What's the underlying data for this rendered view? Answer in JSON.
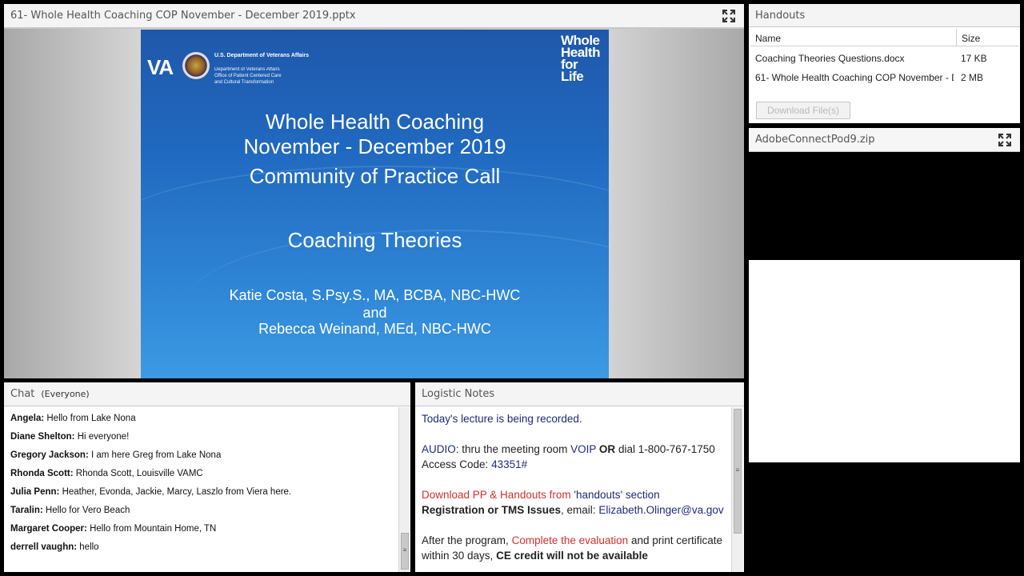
{
  "share_pod": {
    "title": "61- Whole Health Coaching COP November - December  2019.pptx",
    "slide": {
      "va_mark": "VA",
      "department": "U.S. Department of Veterans Affairs",
      "office": "Department of Veterans Affairs Office of Patient Centered Care and Cultural Transformation",
      "brand": "Whole Health for Life",
      "line1": "Whole Health Coaching",
      "line2": "November - December 2019",
      "line3": "Community of Practice Call",
      "topic": "Coaching Theories",
      "presenter1": "Katie Costa, S.Psy.S., MA, BCBA, NBC-HWC",
      "connector": "and",
      "presenter2": "Rebecca Weinand, MEd, NBC-HWC"
    }
  },
  "handouts_pod": {
    "title": "Handouts",
    "columns": {
      "name": "Name",
      "size": "Size"
    },
    "files": [
      {
        "name": "Coaching Theories Questions.docx",
        "size": "17 KB"
      },
      {
        "name": "61- Whole Health Coaching COP November - December  2019.pptx",
        "size": "2 MB"
      }
    ],
    "download_label": "Download File(s)"
  },
  "zip_pod": {
    "title": "AdobeConnectPod9.zip"
  },
  "chat_pod": {
    "title": "Chat",
    "scope": "(Everyone)",
    "messages": [
      {
        "sender": "Angela:",
        "text": "Hello from Lake Nona"
      },
      {
        "sender": "Diane Shelton:",
        "text": "Hi everyone!"
      },
      {
        "sender": "Gregory Jackson:",
        "text": "I am here Greg from Lake Nona"
      },
      {
        "sender": "Rhonda Scott:",
        "text": "Rhonda Scott, Louisville VAMC"
      },
      {
        "sender": "Julia Penn:",
        "text": "Heather, Evonda, Jackie, Marcy, Laszlo from Viera here."
      },
      {
        "sender": "Taralin:",
        "text": "Hello for Vero Beach"
      },
      {
        "sender": "Margaret Cooper:",
        "text": "Hello from Mountain Home, TN"
      },
      {
        "sender": "derrell vaughn:",
        "text": "hello"
      }
    ]
  },
  "notes_pod": {
    "title": "Logistic Notes",
    "recorded": "Today's lecture is being recorded.",
    "audio_label": "AUDIO:",
    "audio_text1": "thru the meeting room",
    "voip": "VOIP",
    "or": "OR",
    "audio_text2": "dial 1-800-767-1750  Access Code:",
    "access_code": "43351#",
    "download_red": "Download PP & Handouts from",
    "handouts_section": "'handouts' section",
    "registration_label": "Registration or TMS Issues",
    "email_text": ", email:",
    "email": "Elizabeth.Olinger@va.gov",
    "after_text": "After the program,",
    "complete_eval": "Complete the evaluation",
    "print_text": "and print certificate within 30 days,",
    "ce_warning": "CE credit will not be available"
  },
  "colors": {
    "notes_navy": "#1f2a7a",
    "notes_red": "#d6312b",
    "slide_blue": "#2069c0"
  }
}
